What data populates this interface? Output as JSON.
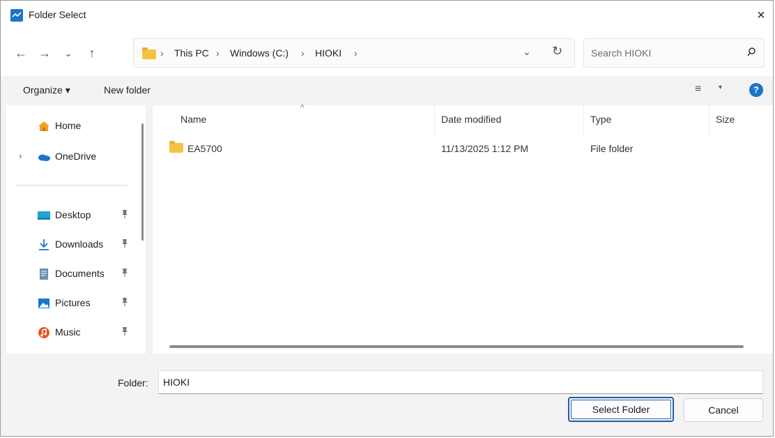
{
  "window": {
    "title": "Folder Select",
    "close_glyph": "×"
  },
  "nav": {
    "back": "←",
    "forward": "→",
    "recent": "⌄",
    "up": "↑",
    "breadcrumb": [
      "This PC",
      "Windows (C:)",
      "HIOKI"
    ],
    "separator": "›",
    "dropdown": "⌄",
    "refresh": "↻",
    "search_placeholder": "Search HIOKI"
  },
  "toolbar": {
    "organize": "Organize ▾",
    "new_folder": "New folder",
    "view": "≡",
    "view_dd": "▾",
    "help": "?"
  },
  "sidebar": {
    "chevron": "›",
    "pin": "📌",
    "items": [
      {
        "label": "Home",
        "icon": "home-icon"
      },
      {
        "label": "OneDrive",
        "icon": "onedrive-icon"
      },
      {
        "label": "Desktop",
        "icon": "desktop-icon"
      },
      {
        "label": "Downloads",
        "icon": "download-icon"
      },
      {
        "label": "Documents",
        "icon": "documents-icon"
      },
      {
        "label": "Pictures",
        "icon": "pictures-icon"
      },
      {
        "label": "Music",
        "icon": "music-icon"
      }
    ]
  },
  "list": {
    "columns": [
      "Name",
      "Date modified",
      "Type",
      "Size"
    ],
    "sort_indicator": "^",
    "rows": [
      {
        "name": "EA5700",
        "date": "11/13/2025 1:12 PM",
        "type": "File folder",
        "size": ""
      }
    ]
  },
  "footer": {
    "folder_label": "Folder:",
    "folder_value": "HIOKI",
    "select_button": "Select Folder",
    "cancel_button": "Cancel"
  },
  "colors": {
    "accent": "#1e74c9",
    "folder": "#f5c342",
    "primary_border": "#1e5aa6"
  }
}
